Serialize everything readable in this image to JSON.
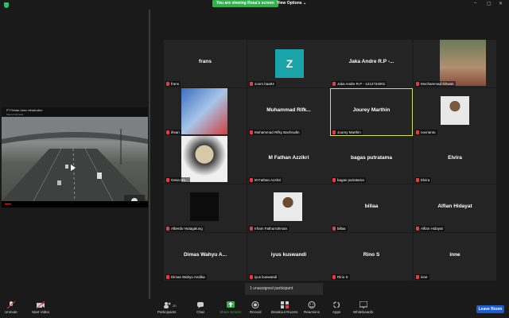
{
  "topbar": {
    "banner": "You are viewing Rosa's screen",
    "view_options": "View Options",
    "view_button": "View"
  },
  "left_video": {
    "title": "PT Rekata Jalan Infrastruktur",
    "channel": "Plaza Indonesia"
  },
  "participants": [
    {
      "center": "frans",
      "label": "frans",
      "type": "name"
    },
    {
      "center": "",
      "label": "zoom baa04",
      "type": "avatar",
      "avatar_letter": "Z"
    },
    {
      "center": "Jaka Andre R.P -...",
      "label": "Jaka Andre R.P - 1212724001",
      "type": "name"
    },
    {
      "center": "",
      "label": "Mochammad Ikhwan",
      "type": "photo"
    },
    {
      "center": "",
      "label": "ihsan",
      "type": "photo"
    },
    {
      "center": "Muhammad Rifk...",
      "label": "Muhammad Rifky Bachrudin",
      "type": "name"
    },
    {
      "center": "Jourey Marthin",
      "label": "Jourey Marthin",
      "type": "name",
      "active": true
    },
    {
      "center": "",
      "label": "novrianto",
      "type": "photo"
    },
    {
      "center": "",
      "label": "Gesa Ha...",
      "type": "photo"
    },
    {
      "center": "M Fathan Azzikri",
      "label": "M Fathan Azzikri",
      "type": "name"
    },
    {
      "center": "bagas putratama",
      "label": "bagas putratama",
      "type": "name"
    },
    {
      "center": "Elvira",
      "label": "Elvira",
      "type": "name"
    },
    {
      "center": "",
      "label": "Alberdo Hutagalung",
      "type": "photo"
    },
    {
      "center": "",
      "label": "Irham Fathurrahman",
      "type": "photo"
    },
    {
      "center": "billaa",
      "label": "billaa",
      "type": "name"
    },
    {
      "center": "Alfian Hidayat",
      "label": "Alfian Hidayat",
      "type": "name"
    },
    {
      "center": "Dimas Wahyu A...",
      "label": "Dimas Wahyu Andika",
      "type": "name"
    },
    {
      "center": "iyus kuswandi",
      "label": "iyus kuswandi",
      "type": "name"
    },
    {
      "center": "Rino S",
      "label": "Rino S",
      "type": "name"
    },
    {
      "center": "inne",
      "label": "inne",
      "type": "name"
    }
  ],
  "unassigned": "1 unassigned participant",
  "toolbar": {
    "unmute": "Unmute",
    "start_video": "Start Video",
    "participants": "Participants",
    "participants_count": "20",
    "chat": "Chat",
    "share_screen": "Share Screen",
    "record": "Record",
    "breakout_rooms": "Breakout Rooms",
    "reactions": "Reactions",
    "apps": "Apps",
    "whiteboards": "Whiteboards",
    "leave": "Leave Room"
  },
  "colors": {
    "banner": "#2fb24a",
    "active_border": "#d4e157",
    "leave": "#1e5cd1",
    "avatar_z": "#1aa3a8"
  }
}
